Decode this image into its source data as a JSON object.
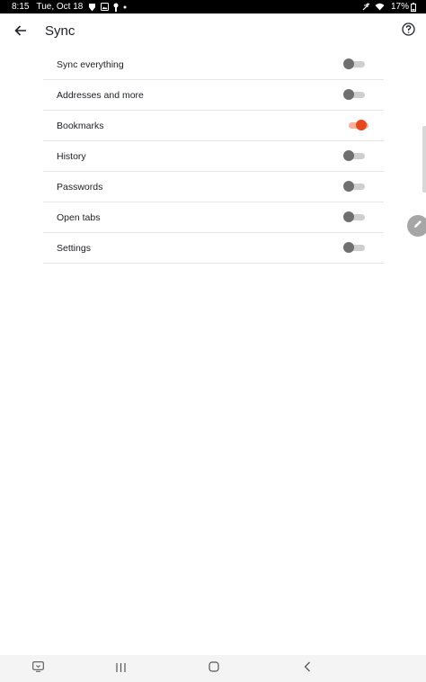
{
  "status_bar": {
    "time": "8:15",
    "date": "Tue, Oct 18",
    "battery": "17%",
    "left_icons": [
      "brave-lion-icon",
      "image-icon",
      "keyhole-icon",
      "dot-icon"
    ],
    "right_icons": [
      "mute-icon",
      "wifi-icon",
      "battery-icon"
    ]
  },
  "app_bar": {
    "title": "Sync",
    "back_icon": "arrow-left-icon",
    "help_icon": "help-circle-icon"
  },
  "sync_items": [
    {
      "label": "Sync everything",
      "enabled": false
    },
    {
      "label": "Addresses and more",
      "enabled": false
    },
    {
      "label": "Bookmarks",
      "enabled": true
    },
    {
      "label": "History",
      "enabled": false
    },
    {
      "label": "Passwords",
      "enabled": false
    },
    {
      "label": "Open tabs",
      "enabled": false
    },
    {
      "label": "Settings",
      "enabled": false
    }
  ],
  "colors": {
    "toggle_on_thumb": "#e8461c",
    "toggle_on_track": "#f6b39a",
    "toggle_off_thumb": "#6f6f6f",
    "toggle_off_track": "#cfcfcf"
  },
  "nav_bar": {
    "buttons": [
      "keyboard-icon",
      "recents-icon",
      "home-icon",
      "back-icon"
    ]
  }
}
